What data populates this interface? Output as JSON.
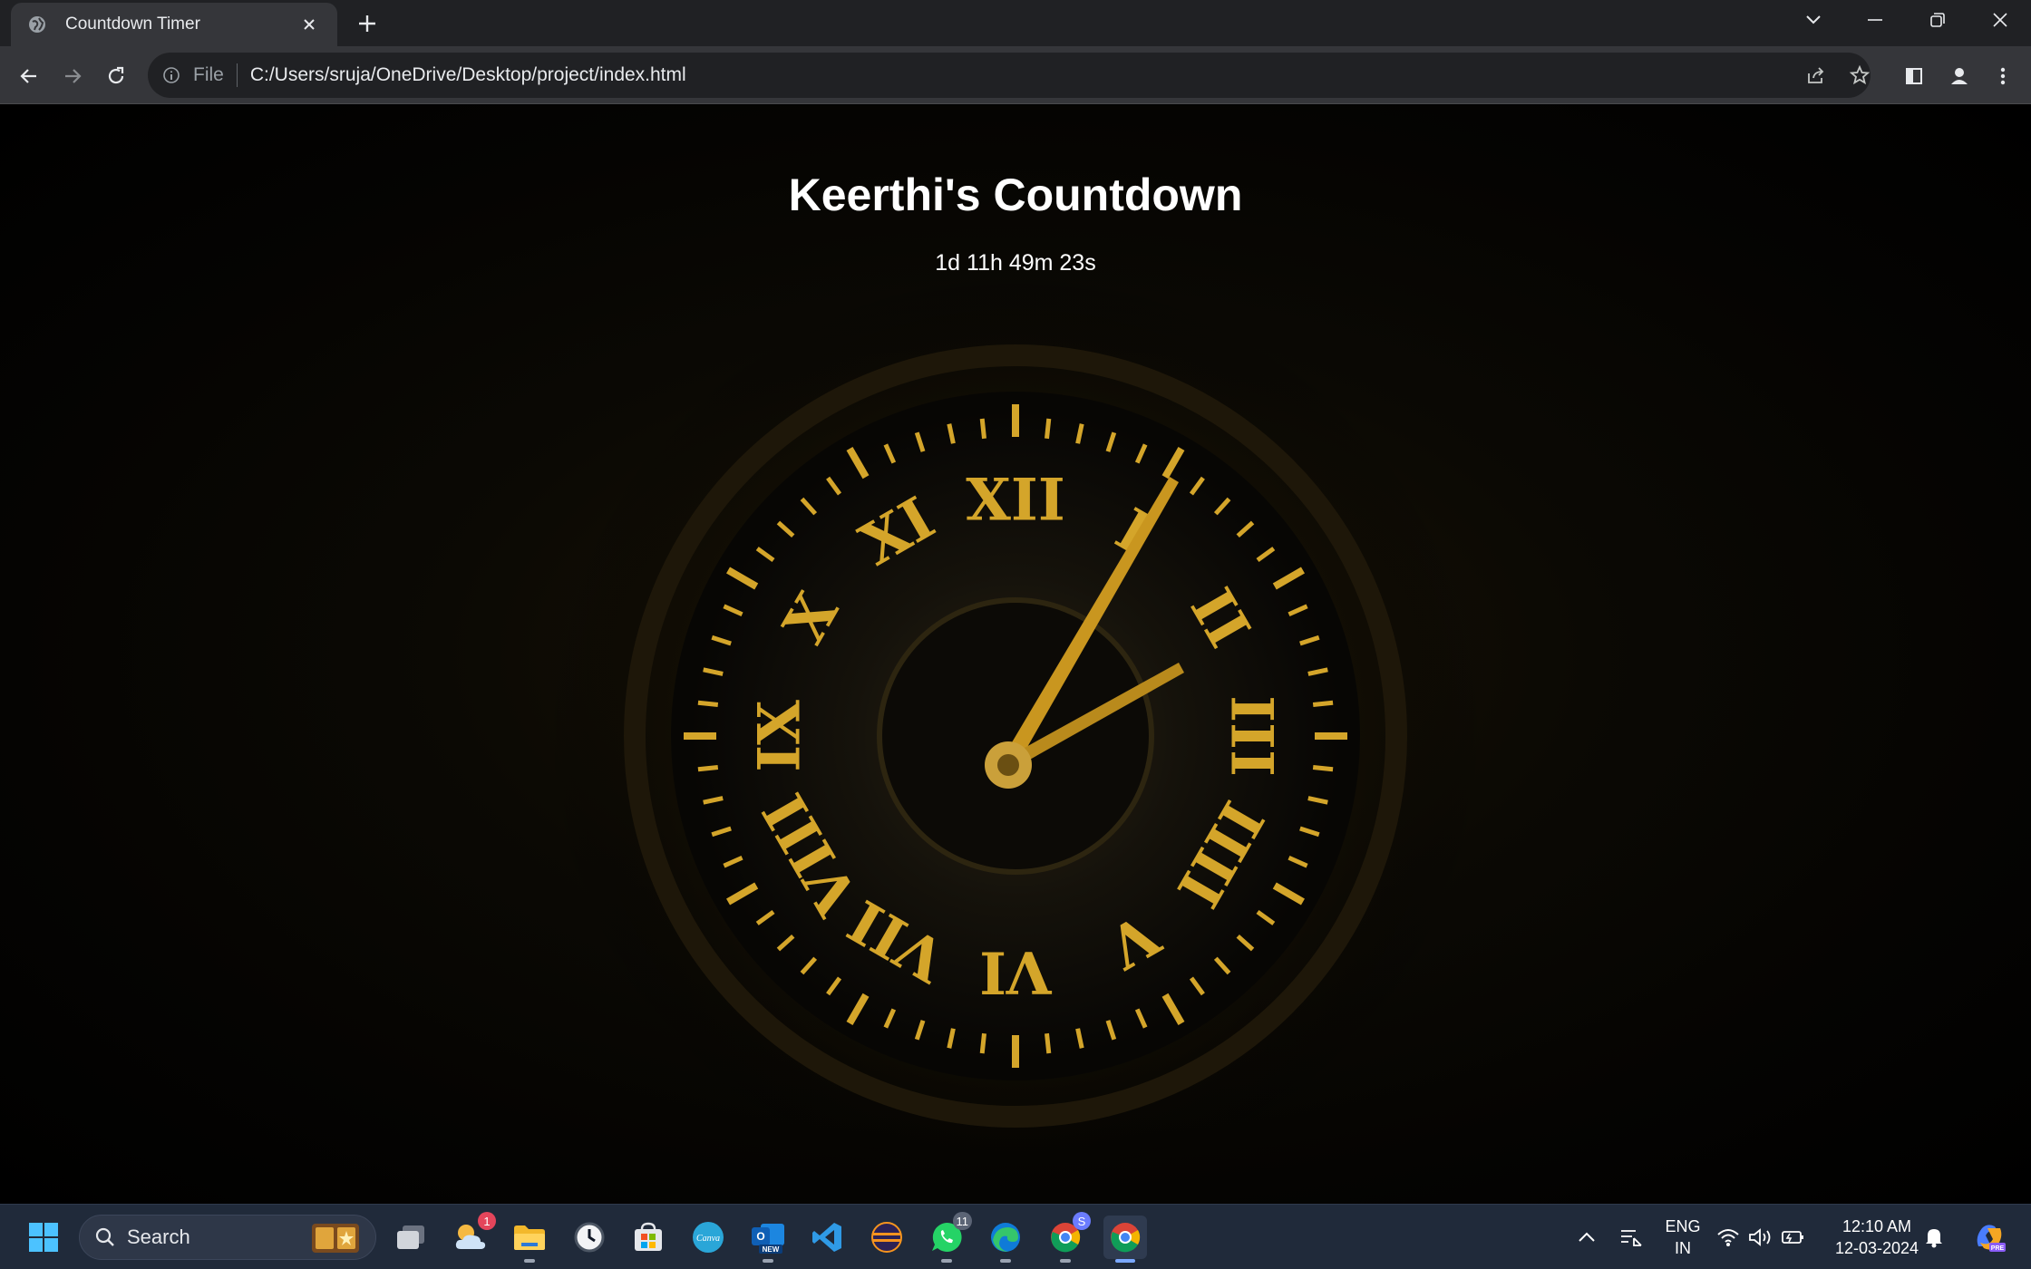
{
  "browser": {
    "tab_title": "Countdown Timer",
    "address_scheme": "File",
    "address_url": "C:/Users/sruja/OneDrive/Desktop/project/index.html"
  },
  "page": {
    "title": "Keerthi's Countdown",
    "countdown": "1d 11h 49m 23s",
    "accent_color": "#d4a52a"
  },
  "clock_numerals": [
    "XII",
    "I",
    "II",
    "III",
    "IIII",
    "V",
    "VI",
    "VII",
    "VIII",
    "IX",
    "X",
    "XI"
  ],
  "taskbar": {
    "search_label": "Search",
    "pinned": [
      {
        "name": "task-view",
        "icon": "task-view-icon"
      },
      {
        "name": "weather",
        "icon": "weather-icon",
        "badge": "1"
      },
      {
        "name": "file-explorer",
        "icon": "folder-icon"
      },
      {
        "name": "clock",
        "icon": "clock-app-icon"
      },
      {
        "name": "microsoft-store",
        "icon": "store-icon"
      },
      {
        "name": "canva",
        "icon": "canva-icon",
        "label": "Canva"
      },
      {
        "name": "outlook",
        "icon": "outlook-icon",
        "label": "NEW"
      },
      {
        "name": "vscode",
        "icon": "vscode-icon"
      },
      {
        "name": "eclipse",
        "icon": "eclipse-icon"
      },
      {
        "name": "whatsapp",
        "icon": "whatsapp-icon",
        "badge": "11"
      },
      {
        "name": "edge",
        "icon": "edge-icon"
      },
      {
        "name": "chrome-profile",
        "icon": "chrome-icon",
        "badge": "S"
      },
      {
        "name": "chrome",
        "icon": "chrome-icon"
      }
    ],
    "tray": {
      "lang_top": "ENG",
      "lang_bottom": "IN",
      "time": "12:10 AM",
      "date": "12-03-2024"
    }
  }
}
